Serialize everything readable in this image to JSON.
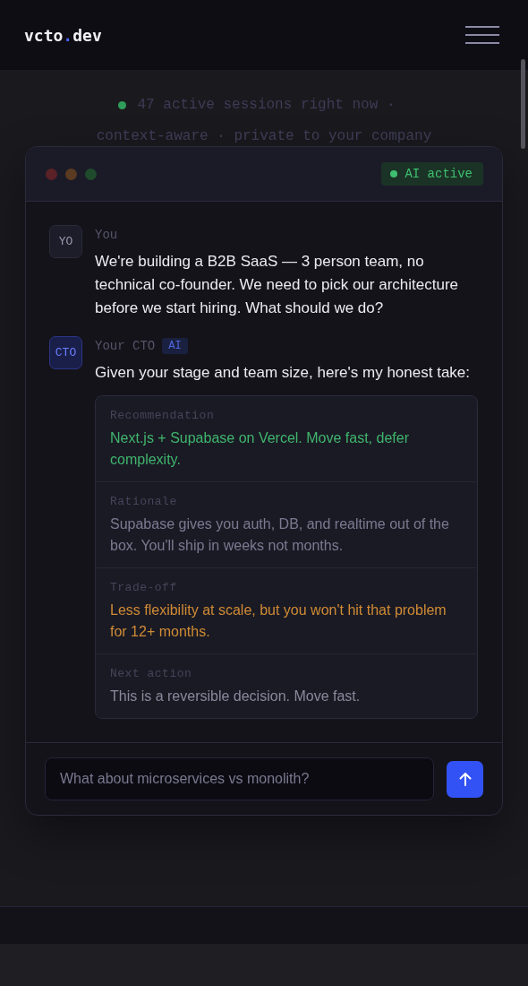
{
  "logo": {
    "name": "vcto",
    "dot": ".",
    "tld": "dev"
  },
  "status": {
    "text": "47 active sessions right now ·",
    "color": "#2f9e5a"
  },
  "tagline": "context-aware · private to your company",
  "chat_window": {
    "badge": "AI active",
    "messages": [
      {
        "kind": "user",
        "avatar": "YO",
        "author": "You",
        "text": "We're building a B2B SaaS — 3 person team, no technical co-founder. We need to pick our architecture before we start hiring. What should we do?"
      },
      {
        "kind": "ai",
        "avatar": "CTO",
        "author": "Your CTO",
        "tag": "AI",
        "text": "Given your stage and team size, here's my honest take:",
        "sections": [
          {
            "label": "Recommendation",
            "text": "Next.js + Supabase on Vercel. Move fast, defer complexity.",
            "color": "#3fb56d"
          },
          {
            "label": "Rationale",
            "text": "Supabase gives you auth, DB, and realtime out of the box. You'll ship in weeks not months.",
            "color": "#7b7a92"
          },
          {
            "label": "Trade-off",
            "text": "Less flexibility at scale, but you won't hit that problem for 12+ months.",
            "color": "#d08b35"
          },
          {
            "label": "Next action",
            "text": "This is a reversible decision. Move fast.",
            "color": "#8a899c"
          }
        ]
      }
    ],
    "input": {
      "placeholder": "What about microservices vs monolith?"
    }
  }
}
